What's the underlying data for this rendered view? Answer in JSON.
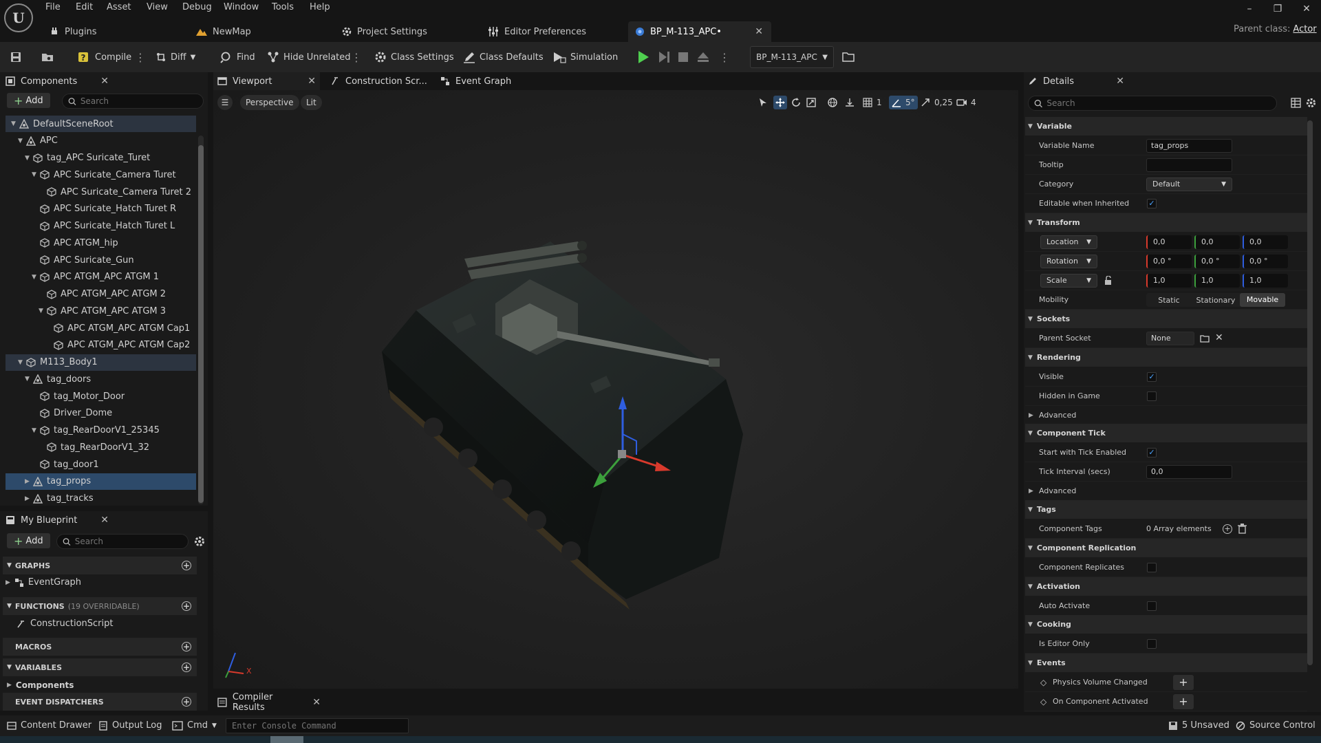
{
  "menu": {
    "logo": "U",
    "items": [
      "File",
      "Edit",
      "Asset",
      "View",
      "Debug",
      "Window",
      "Tools",
      "Help"
    ]
  },
  "window_controls": {
    "minimize": "–",
    "restore": "❐",
    "close": "✕"
  },
  "tabs": {
    "plugins": "Plugins",
    "newmap": "NewMap",
    "project_settings": "Project Settings",
    "editor_prefs": "Editor Preferences",
    "blueprint": "BP_M-113_APC•"
  },
  "parent_class": {
    "label": "Parent class:",
    "value": "Actor"
  },
  "toolbar": {
    "compile": "Compile",
    "diff": "Diff",
    "find": "Find",
    "hide_unrelated": "Hide Unrelated",
    "class_settings": "Class Settings",
    "class_defaults": "Class Defaults",
    "simulation": "Simulation",
    "debug_object": "BP_M-113_APC"
  },
  "components": {
    "tab": "Components",
    "add": "Add",
    "search_placeholder": "Search",
    "tree": [
      {
        "label": "DefaultSceneRoot",
        "depth": 0,
        "expand": "open",
        "icon": "scene"
      },
      {
        "label": "APC",
        "depth": 1,
        "expand": "open",
        "icon": "scene"
      },
      {
        "label": "tag_APC Suricate_Turet",
        "depth": 2,
        "expand": "open",
        "icon": "mesh"
      },
      {
        "label": "APC Suricate_Camera Turet",
        "depth": 3,
        "expand": "open",
        "icon": "mesh"
      },
      {
        "label": "APC Suricate_Camera Turet 2",
        "depth": 4,
        "expand": "",
        "icon": "mesh"
      },
      {
        "label": "APC Suricate_Hatch Turet R",
        "depth": 3,
        "expand": "",
        "icon": "mesh"
      },
      {
        "label": "APC Suricate_Hatch Turet L",
        "depth": 3,
        "expand": "",
        "icon": "mesh"
      },
      {
        "label": "APC ATGM_hip",
        "depth": 3,
        "expand": "",
        "icon": "mesh"
      },
      {
        "label": "APC Suricate_Gun",
        "depth": 3,
        "expand": "",
        "icon": "mesh"
      },
      {
        "label": "APC ATGM_APC ATGM 1",
        "depth": 3,
        "expand": "open",
        "icon": "mesh"
      },
      {
        "label": "APC ATGM_APC ATGM 2",
        "depth": 4,
        "expand": "",
        "icon": "mesh"
      },
      {
        "label": "APC ATGM_APC ATGM 3",
        "depth": 4,
        "expand": "open",
        "icon": "mesh"
      },
      {
        "label": "APC ATGM_APC ATGM Cap1",
        "depth": 5,
        "expand": "",
        "icon": "mesh"
      },
      {
        "label": "APC ATGM_APC ATGM Cap2",
        "depth": 5,
        "expand": "",
        "icon": "mesh"
      },
      {
        "label": "M113_Body1",
        "depth": 1,
        "expand": "open",
        "icon": "mesh"
      },
      {
        "label": "tag_doors",
        "depth": 2,
        "expand": "open",
        "icon": "scene"
      },
      {
        "label": "tag_Motor_Door",
        "depth": 3,
        "expand": "",
        "icon": "mesh"
      },
      {
        "label": "Driver_Dome",
        "depth": 3,
        "expand": "",
        "icon": "mesh"
      },
      {
        "label": "tag_RearDoorV1_25345",
        "depth": 3,
        "expand": "open",
        "icon": "mesh"
      },
      {
        "label": "tag_RearDoorV1_32",
        "depth": 4,
        "expand": "",
        "icon": "mesh"
      },
      {
        "label": "tag_door1",
        "depth": 3,
        "expand": "",
        "icon": "mesh"
      },
      {
        "label": "tag_props",
        "depth": 2,
        "expand": "closed",
        "icon": "scene"
      },
      {
        "label": "tag_tracks",
        "depth": 2,
        "expand": "closed",
        "icon": "scene"
      }
    ]
  },
  "my_blueprint": {
    "tab": "My Blueprint",
    "add": "Add",
    "search_placeholder": "Search",
    "graphs": "GRAPHS",
    "event_graph": "EventGraph",
    "functions": "FUNCTIONS",
    "functions_count": "(19 OVERRIDABLE)",
    "construction_script": "ConstructionScript",
    "macros": "MACROS",
    "variables": "VARIABLES",
    "components": "Components",
    "event_dispatchers": "EVENT DISPATCHERS"
  },
  "editor_tabs": {
    "viewport": "Viewport",
    "construction": "Construction Scr...",
    "event_graph": "Event Graph"
  },
  "viewport": {
    "perspective": "Perspective",
    "lit": "Lit",
    "grid_size": "1",
    "angle": "5°",
    "scale": "0,25",
    "camera_speed": "4",
    "axis_x": "X"
  },
  "details": {
    "tab": "Details",
    "search_placeholder": "Search",
    "variable": {
      "header": "Variable",
      "name_label": "Variable Name",
      "name_value": "tag_props",
      "tooltip_label": "Tooltip",
      "tooltip_value": "",
      "category_label": "Category",
      "category_value": "Default",
      "editable_label": "Editable when Inherited"
    },
    "transform": {
      "header": "Transform",
      "location": "Location",
      "location_values": [
        "0,0",
        "0,0",
        "0,0"
      ],
      "rotation": "Rotation",
      "rotation_values": [
        "0,0 °",
        "0,0 °",
        "0,0 °"
      ],
      "scale": "Scale",
      "scale_values": [
        "1,0",
        "1,0",
        "1,0"
      ],
      "mobility_label": "Mobility",
      "mobility_options": [
        "Static",
        "Stationary",
        "Movable"
      ],
      "mobility_selected": "Movable"
    },
    "sockets": {
      "header": "Sockets",
      "parent_label": "Parent Socket",
      "parent_value": "None"
    },
    "rendering": {
      "header": "Rendering",
      "visible_label": "Visible",
      "hidden_label": "Hidden in Game",
      "advanced": "Advanced"
    },
    "component_tick": {
      "header": "Component Tick",
      "start_label": "Start with Tick Enabled",
      "interval_label": "Tick Interval (secs)",
      "interval_value": "0,0",
      "advanced": "Advanced"
    },
    "tags": {
      "header": "Tags",
      "component_tags_label": "Component Tags",
      "component_tags_value": "0 Array elements"
    },
    "replication": {
      "header": "Component Replication",
      "replicates_label": "Component Replicates"
    },
    "activation": {
      "header": "Activation",
      "auto_label": "Auto Activate"
    },
    "cooking": {
      "header": "Cooking",
      "editor_only_label": "Is Editor Only"
    },
    "events": {
      "header": "Events",
      "physics_label": "Physics Volume Changed",
      "activated_label": "On Component Activated"
    }
  },
  "compiler_results": "Compiler Results",
  "statusbar": {
    "content_drawer": "Content Drawer",
    "output_log": "Output Log",
    "cmd": "Cmd",
    "console_placeholder": "Enter Console Command",
    "unsaved": "5 Unsaved",
    "source_control": "Source Control"
  },
  "colors": {
    "accent": "#4aa3ff",
    "play_green": "#4fcf4f",
    "selection": "#2d4a6a"
  }
}
